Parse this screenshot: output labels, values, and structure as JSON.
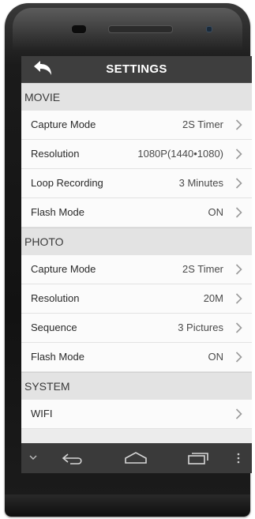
{
  "header": {
    "title": "SETTINGS"
  },
  "sections": [
    {
      "title": "MOVIE",
      "items": [
        {
          "label": "Capture Mode",
          "value": "2S Timer"
        },
        {
          "label": "Resolution",
          "value": "1080P(1440•1080)"
        },
        {
          "label": "Loop Recording",
          "value": "3 Minutes"
        },
        {
          "label": "Flash Mode",
          "value": "ON"
        }
      ]
    },
    {
      "title": "PHOTO",
      "items": [
        {
          "label": "Capture Mode",
          "value": "2S Timer"
        },
        {
          "label": "Resolution",
          "value": "20M"
        },
        {
          "label": "Sequence",
          "value": "3 Pictures"
        },
        {
          "label": "Flash Mode",
          "value": "ON"
        }
      ]
    },
    {
      "title": "SYSTEM",
      "items": [
        {
          "label": "WIFI",
          "value": ""
        }
      ]
    }
  ],
  "icons": {
    "back": "back-arrow-icon",
    "chevron": "chevron-right-icon",
    "nav": [
      "chevron-down-icon",
      "back-icon",
      "home-icon",
      "recent-apps-icon",
      "menu-icon"
    ]
  },
  "colors": {
    "topbar": "#3e3e3e",
    "section_bg": "#e3e3e3",
    "row_bg": "#fbfbfb",
    "navbar": "#3a3a3a"
  }
}
